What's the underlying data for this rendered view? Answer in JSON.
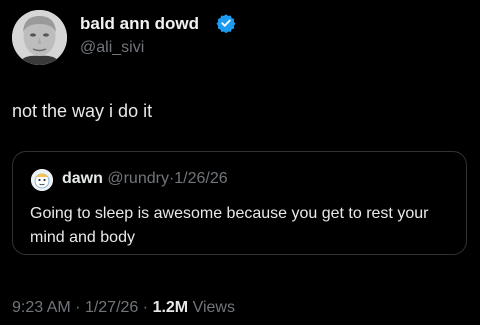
{
  "author": {
    "display_name": "bald ann dowd",
    "handle": "@ali_sivi",
    "verified": true,
    "verified_color": "#1d9bf0",
    "avatar_icon": "profile-photo"
  },
  "tweet": {
    "text": "not the way i do it"
  },
  "quote": {
    "display_name": "dawn",
    "handle": "@rundry",
    "separator": "·",
    "date": "1/26/26",
    "text": "Going to sleep is awesome because you get to rest your mind and body",
    "avatar_icon": "cartoon-avatar"
  },
  "meta": {
    "time": "9:23 AM",
    "sep1": "·",
    "date": "1/27/26",
    "sep2": "·",
    "views_count": "1.2M",
    "views_label": "Views"
  },
  "colors": {
    "background": "#000000",
    "text_primary": "#e7e9ea",
    "text_secondary": "#71767b",
    "border": "#2f3336"
  }
}
